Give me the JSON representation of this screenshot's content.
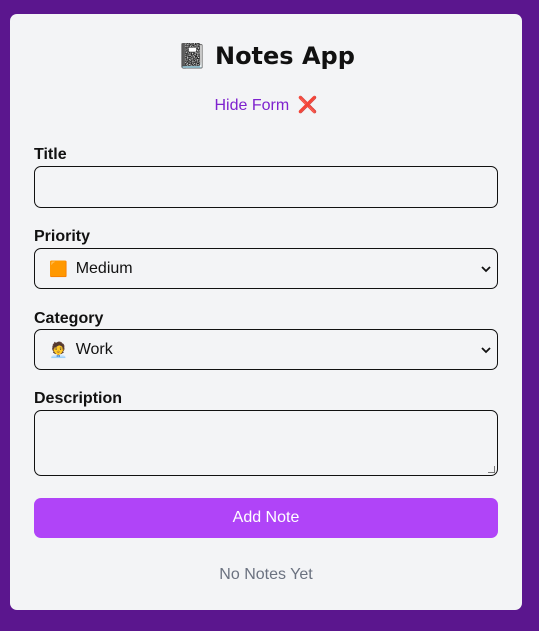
{
  "app": {
    "title": "Notes App",
    "title_icon": "📓"
  },
  "toggle": {
    "label": "Hide Form",
    "icon": "❌"
  },
  "form": {
    "title_label": "Title",
    "title_value": "",
    "priority_label": "Priority",
    "priority_emoji": "🟧",
    "priority_value": "Medium",
    "category_label": "Category",
    "category_emoji": "🧑‍💼",
    "category_value": "Work",
    "description_label": "Description",
    "description_value": "",
    "submit_label": "Add Note"
  },
  "notes": {
    "empty_text": "No Notes Yet"
  },
  "colors": {
    "background": "#5b168e",
    "card": "#f3f4f6",
    "accent": "#b044f8",
    "link": "#7e22ce",
    "muted": "#6b7280"
  }
}
